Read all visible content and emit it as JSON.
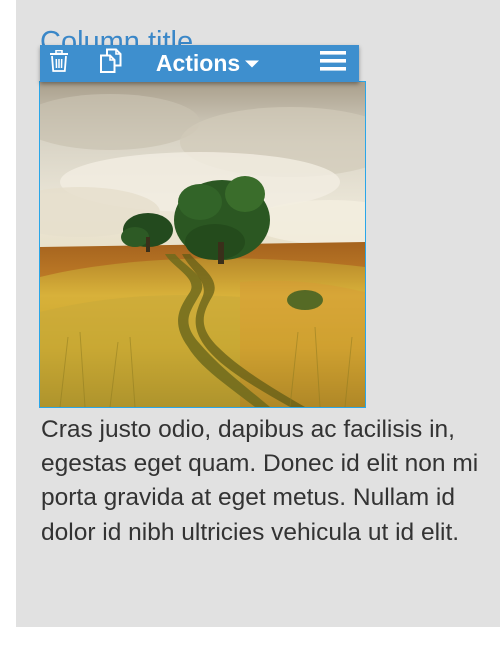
{
  "column": {
    "title": "Column title",
    "body_text": "Cras justo odio, dapibus ac facilisis in, egestas eget quam. Donec id elit non mi porta gravida at eget metus. Nullam id dolor id nibh ultricies vehicula ut id elit."
  },
  "toolbar": {
    "delete_icon": "trash-icon",
    "duplicate_icon": "copy-icon",
    "actions_label": "Actions",
    "actions_caret_icon": "caret-down-icon",
    "menu_icon": "hamburger-menu-icon"
  },
  "image": {
    "subject": "landscape-photo"
  },
  "colors": {
    "toolbar": "#3e8fce",
    "title": "#3a87c8",
    "selection_border": "#2aa6e8",
    "column_background": "#e1e1e1",
    "body_text": "#333333"
  }
}
